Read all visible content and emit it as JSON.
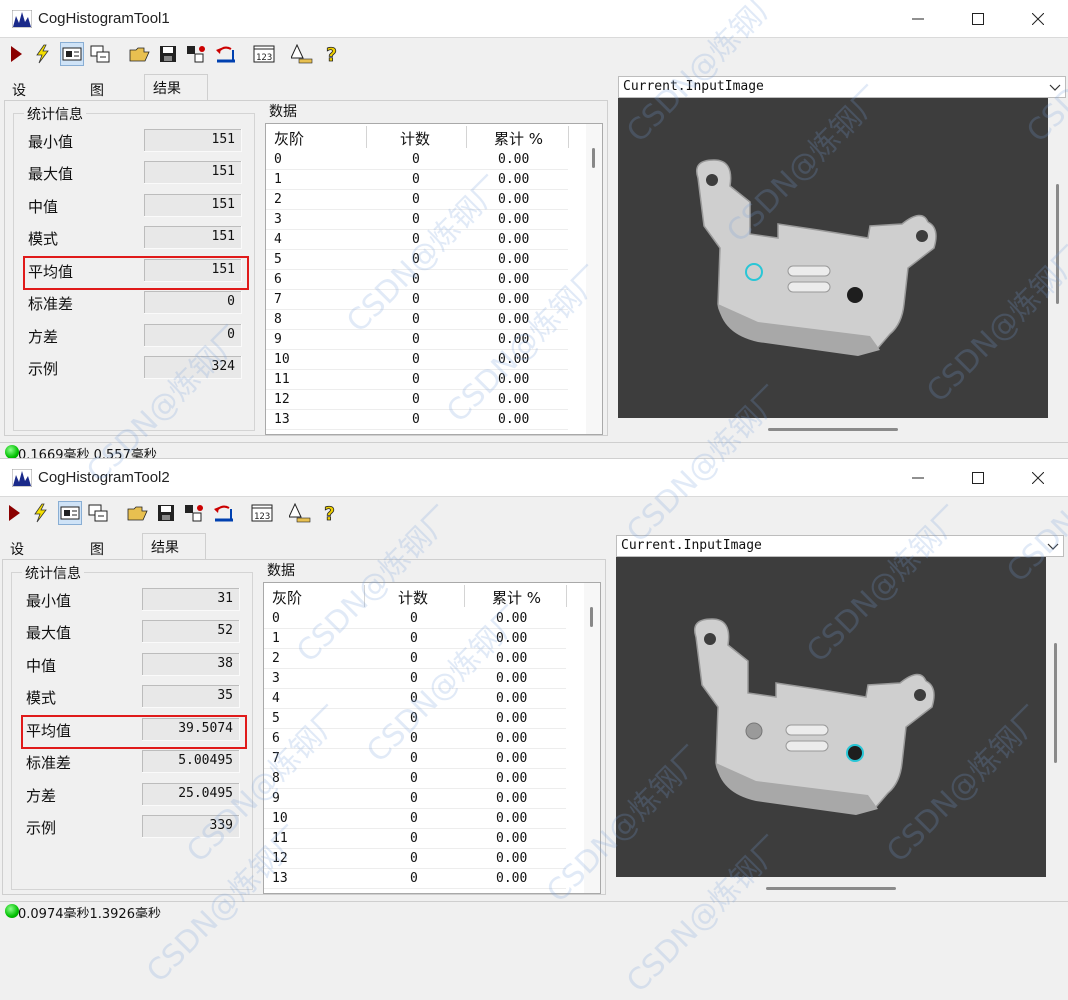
{
  "windows": [
    {
      "title": "CogHistogramTool1",
      "tabs": [
        "设置/区域",
        "图形",
        "结果"
      ],
      "stats_group_title": "统计信息",
      "stats": [
        {
          "label": "最小值",
          "value": "151"
        },
        {
          "label": "最大值",
          "value": "151"
        },
        {
          "label": "中值",
          "value": "151"
        },
        {
          "label": "模式",
          "value": "151"
        },
        {
          "label": "平均值",
          "value": "151"
        },
        {
          "label": "标准差",
          "value": "0"
        },
        {
          "label": "方差",
          "value": "0"
        },
        {
          "label": "示例",
          "value": "324"
        }
      ],
      "data_title": "数据",
      "grid_headers": [
        "灰阶",
        "计数",
        "累计 %"
      ],
      "grid_rows": [
        [
          "0",
          "0",
          "0.00"
        ],
        [
          "1",
          "0",
          "0.00"
        ],
        [
          "2",
          "0",
          "0.00"
        ],
        [
          "3",
          "0",
          "0.00"
        ],
        [
          "4",
          "0",
          "0.00"
        ],
        [
          "5",
          "0",
          "0.00"
        ],
        [
          "6",
          "0",
          "0.00"
        ],
        [
          "7",
          "0",
          "0.00"
        ],
        [
          "8",
          "0",
          "0.00"
        ],
        [
          "9",
          "0",
          "0.00"
        ],
        [
          "10",
          "0",
          "0.00"
        ],
        [
          "11",
          "0",
          "0.00"
        ],
        [
          "12",
          "0",
          "0.00"
        ],
        [
          "13",
          "0",
          "0.00"
        ]
      ],
      "image_source": "Current.InputImage",
      "status_text": "0.1669毫秒 0.557毫秒",
      "highlight_index": 4
    },
    {
      "title": "CogHistogramTool2",
      "tabs": [
        "设置/区域",
        "图形",
        "结果"
      ],
      "stats_group_title": "统计信息",
      "stats": [
        {
          "label": "最小值",
          "value": "31"
        },
        {
          "label": "最大值",
          "value": "52"
        },
        {
          "label": "中值",
          "value": "38"
        },
        {
          "label": "模式",
          "value": "35"
        },
        {
          "label": "平均值",
          "value": "39.5074"
        },
        {
          "label": "标准差",
          "value": "5.00495"
        },
        {
          "label": "方差",
          "value": "25.0495"
        },
        {
          "label": "示例",
          "value": "339"
        }
      ],
      "data_title": "数据",
      "grid_headers": [
        "灰阶",
        "计数",
        "累计 %"
      ],
      "grid_rows": [
        [
          "0",
          "0",
          "0.00"
        ],
        [
          "1",
          "0",
          "0.00"
        ],
        [
          "2",
          "0",
          "0.00"
        ],
        [
          "3",
          "0",
          "0.00"
        ],
        [
          "4",
          "0",
          "0.00"
        ],
        [
          "5",
          "0",
          "0.00"
        ],
        [
          "6",
          "0",
          "0.00"
        ],
        [
          "7",
          "0",
          "0.00"
        ],
        [
          "8",
          "0",
          "0.00"
        ],
        [
          "9",
          "0",
          "0.00"
        ],
        [
          "10",
          "0",
          "0.00"
        ],
        [
          "11",
          "0",
          "0.00"
        ],
        [
          "12",
          "0",
          "0.00"
        ],
        [
          "13",
          "0",
          "0.00"
        ]
      ],
      "image_source": "Current.InputImage",
      "status_text": "0.0974毫秒1.3926毫秒",
      "highlight_index": 4
    }
  ],
  "watermark_text": "CSDN@炼钢厂",
  "colors": {
    "highlight": "#e01a1a",
    "status_led": "#00c000",
    "image_bg": "#3f3f3f",
    "roi_circle": "#29c6d6"
  },
  "icons": {
    "toolbar": [
      "run-icon",
      "electric-run-icon",
      "show-record-icon",
      "floating-window-icon",
      "open-icon",
      "save-icon",
      "reset-icon",
      "reset-ref-icon",
      "display-123-icon",
      "calibration-icon",
      "help-icon"
    ]
  }
}
